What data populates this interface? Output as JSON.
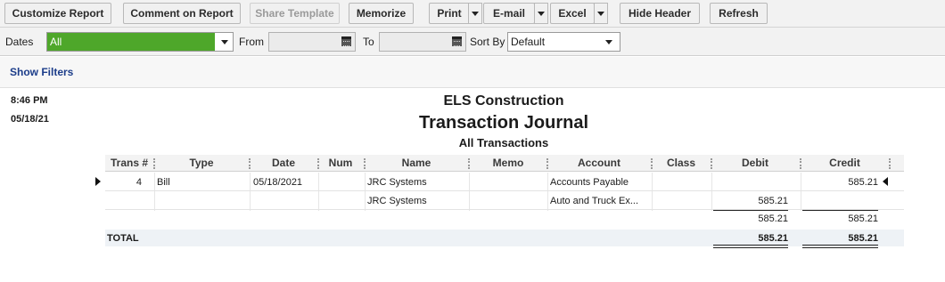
{
  "toolbar": {
    "customize": "Customize Report",
    "comment": "Comment on Report",
    "share": "Share Template",
    "memorize": "Memorize",
    "print": "Print",
    "email": "E-mail",
    "excel": "Excel",
    "hide_header": "Hide Header",
    "refresh": "Refresh"
  },
  "filters": {
    "dates_label": "Dates",
    "dates_value": "All",
    "from_label": "From",
    "to_label": "To",
    "from_value": "",
    "to_value": "",
    "sortby_label": "Sort By",
    "sortby_value": "Default",
    "show_filters": "Show Filters"
  },
  "report": {
    "time": "8:46 PM",
    "date": "05/18/21",
    "company": "ELS Construction",
    "title": "Transaction Journal",
    "subtitle": "All Transactions",
    "columns": [
      "Trans #",
      "Type",
      "Date",
      "Num",
      "Name",
      "Memo",
      "Account",
      "Class",
      "Debit",
      "Credit"
    ],
    "rows": [
      {
        "trans": "4",
        "type": "Bill",
        "date": "05/18/2021",
        "num": "",
        "name": "JRC Systems",
        "memo": "",
        "account": "Accounts Payable",
        "class": "",
        "debit": "",
        "credit": "585.21"
      },
      {
        "trans": "",
        "type": "",
        "date": "",
        "num": "",
        "name": "JRC Systems",
        "memo": "",
        "account": "Auto and Truck Ex...",
        "class": "",
        "debit": "585.21",
        "credit": ""
      }
    ],
    "subtotal": {
      "debit": "585.21",
      "credit": "585.21"
    },
    "total": {
      "label": "TOTAL",
      "debit": "585.21",
      "credit": "585.21"
    }
  }
}
